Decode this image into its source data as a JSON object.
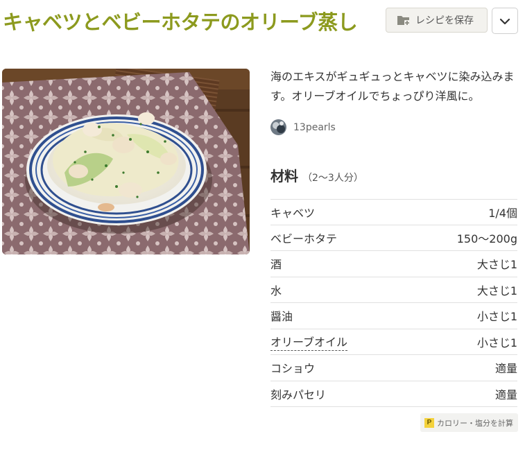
{
  "recipe": {
    "title": "キャベツとベビーホタテのオリーブ蒸し",
    "description": "海のエキスがギュギュっとキャベツに染み込みます。オリーブオイルでちょっぴり洋風に。",
    "author": "13pearls",
    "photo_icon": "recipe-photo"
  },
  "toolbar": {
    "save_label": "レシピを保存",
    "save_icon": "folder-plus-icon",
    "menu_icon": "chevron-down-icon"
  },
  "ingredients": {
    "heading": "材料",
    "servings": "（2〜3人分）",
    "items": [
      {
        "name": "キャベツ",
        "qty": "1/4個"
      },
      {
        "name": "ベビーホタテ",
        "qty": "150〜200g"
      },
      {
        "name": "酒",
        "qty": "大さじ1"
      },
      {
        "name": "水",
        "qty": "大さじ1"
      },
      {
        "name": "醤油",
        "qty": "小さじ1"
      },
      {
        "name": "オリーブオイル",
        "qty": "小さじ1",
        "link": true
      },
      {
        "name": "コショウ",
        "qty": "適量"
      },
      {
        "name": "刻みパセリ",
        "qty": "適量"
      }
    ]
  },
  "calorie": {
    "icon_letter": "P",
    "label": "カロリー・塩分を計算"
  },
  "colors": {
    "title": "#8c9a1e",
    "text": "#333333",
    "divider": "#e0e0e0"
  }
}
